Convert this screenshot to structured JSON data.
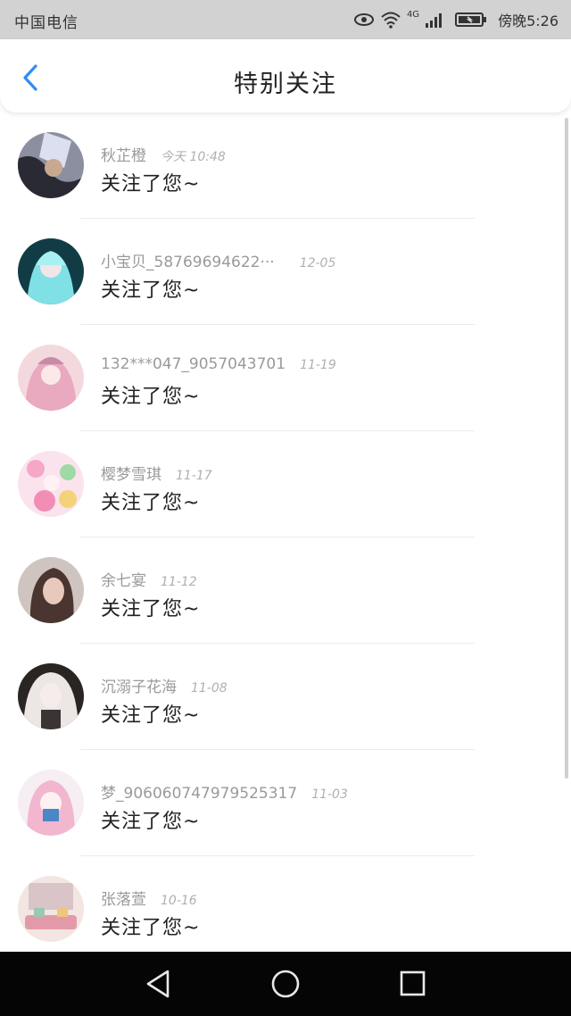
{
  "status_bar": {
    "carrier": "中国电信",
    "network": "4G",
    "time": "傍晚5:26"
  },
  "header": {
    "title": "特别关注",
    "back_icon": "chevron-left-icon",
    "accent_color": "#2f8df5"
  },
  "items": [
    {
      "name": "秋芷橙",
      "date": "今天 10:48",
      "message": "关注了您~",
      "avatar_color": "#6b6f80"
    },
    {
      "name": "小宝贝_58769694622···",
      "date": "12-05",
      "message": "关注了您~",
      "avatar_color": "#1d6a6f"
    },
    {
      "name": "132***047_9057043701",
      "date": "11-19",
      "message": "关注了您~",
      "avatar_color": "#e7b9c6"
    },
    {
      "name": "樱梦雪琪",
      "date": "11-17",
      "message": "关注了您~",
      "avatar_color": "#f1a7c8"
    },
    {
      "name": "余七宴",
      "date": "11-12",
      "message": "关注了您~",
      "avatar_color": "#8a6e66"
    },
    {
      "name": "沉溺子花海",
      "date": "11-08",
      "message": "关注了您~",
      "avatar_color": "#d9d2d0"
    },
    {
      "name": "梦_906060747979525317",
      "date": "11-03",
      "message": "关注了您~",
      "avatar_color": "#8fc6e9"
    },
    {
      "name": "张落萱",
      "date": "10-16",
      "message": "关注了您~",
      "avatar_color": "#e8b8a8"
    }
  ],
  "nav_bar": {
    "back": "triangle-back-icon",
    "home": "circle-home-icon",
    "recent": "square-recent-icon"
  }
}
